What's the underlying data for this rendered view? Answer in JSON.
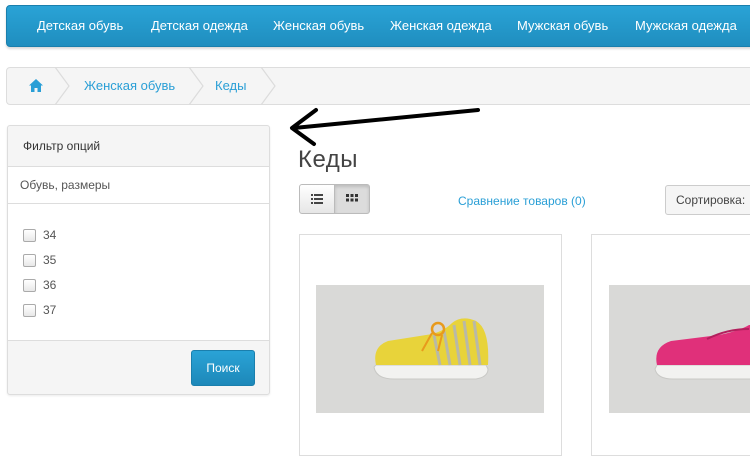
{
  "nav": {
    "items": [
      "Детская обувь",
      "Детская одежда",
      "Женская обувь",
      "Женская одежда",
      "Мужская обувь",
      "Мужская одежда"
    ]
  },
  "breadcrumb": {
    "home_icon": "home-icon",
    "items": [
      "Женская обувь",
      "Кеды"
    ]
  },
  "filter": {
    "heading": "Фильтр опций",
    "group_title": "Обувь, размеры",
    "options": [
      "34",
      "35",
      "36",
      "37"
    ],
    "search_button": "Поиск"
  },
  "content": {
    "title": "Кеды",
    "view_icons": [
      "list-view-icon",
      "grid-view-icon"
    ],
    "compare_link": "Сравнение товаров (0)",
    "sort_label": "Сортировка:"
  },
  "products": [
    {
      "image": "yellow striped sneaker photo"
    },
    {
      "image": "pink sneaker photo"
    }
  ],
  "colors": {
    "accent": "#2a9fd6",
    "nav_bg": "#1f8ebf"
  }
}
